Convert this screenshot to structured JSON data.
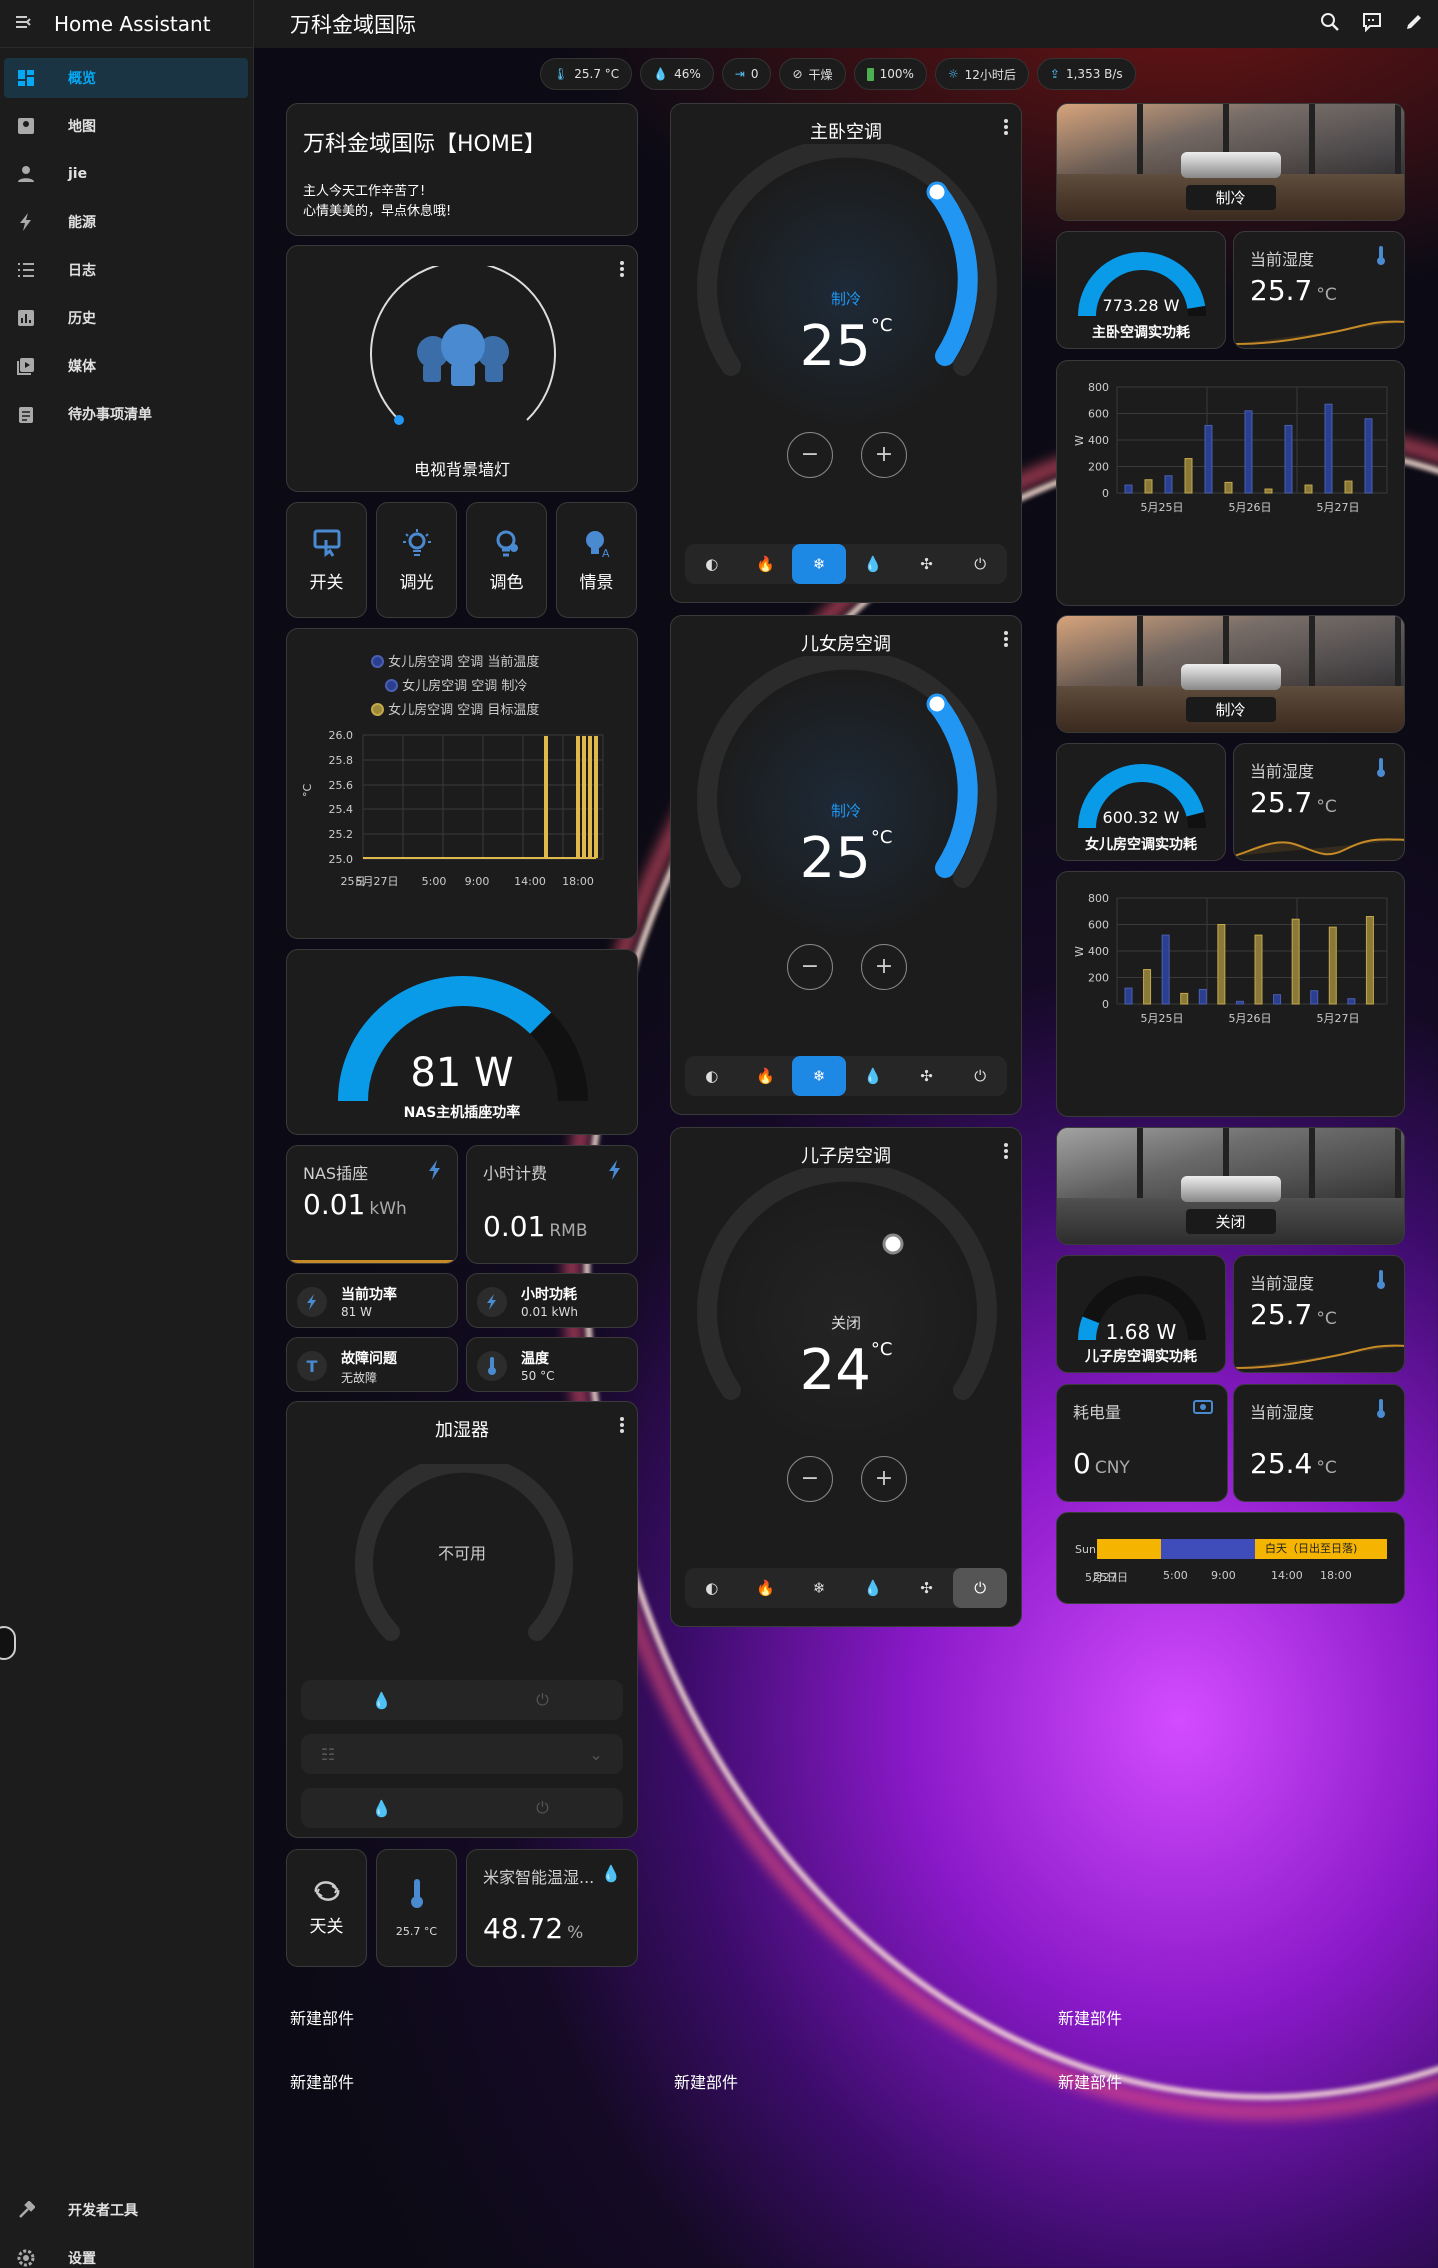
{
  "app": {
    "title": "Home Assistant",
    "page_title": "万科金域国际"
  },
  "sidebar": {
    "items": [
      {
        "label": "概览",
        "icon": "dashboard-icon"
      },
      {
        "label": "地图",
        "icon": "map-icon"
      },
      {
        "label": "jie",
        "icon": "person-icon"
      },
      {
        "label": "能源",
        "icon": "lightning-icon"
      },
      {
        "label": "日志",
        "icon": "list-icon"
      },
      {
        "label": "历史",
        "icon": "chart-icon"
      },
      {
        "label": "媒体",
        "icon": "media-icon"
      },
      {
        "label": "待办事项清单",
        "icon": "clipboard-icon"
      }
    ],
    "bottom": [
      {
        "label": "开发者工具",
        "icon": "hammer-icon"
      },
      {
        "label": "设置",
        "icon": "gear-icon"
      }
    ]
  },
  "badges": [
    {
      "icon": "thermometer-icon",
      "text": "25.7 °C"
    },
    {
      "icon": "drop-icon",
      "text": "46%"
    },
    {
      "icon": "arrow-icon",
      "text": "0"
    },
    {
      "icon": "no-rain-icon",
      "text": "干燥"
    },
    {
      "icon": "battery-icon",
      "text": "100%"
    },
    {
      "icon": "weather-icon",
      "text": "12小时后"
    },
    {
      "icon": "upload-icon",
      "text": "1,353 B/s"
    }
  ],
  "welcome": {
    "title": "万科金域国际【HOME】",
    "line1": "主人今天工作辛苦了!",
    "line2": "心情美美的，早点休息哦!"
  },
  "light": {
    "name": "电视背景墙灯"
  },
  "light_tiles": [
    {
      "label": "开关"
    },
    {
      "label": "调光"
    },
    {
      "label": "调色"
    },
    {
      "label": "情景"
    }
  ],
  "girl_history": {
    "legend": [
      "女儿房空调 空调 当前温度",
      "女儿房空调 空调 制冷",
      "女儿房空调 空调 目标温度"
    ],
    "yticks": [
      "26.0",
      "25.8",
      "25.6",
      "25.4",
      "25.2",
      "25.0"
    ],
    "ylabel": "°C",
    "xticks": [
      "5月27日",
      "5:00",
      "9:00",
      "14:00",
      "18:00"
    ],
    "xticks_overlap": "25日"
  },
  "nas": {
    "value": "81 W",
    "name": "NAS主机插座功率",
    "gauge_fraction": 0.75
  },
  "nas_stats": [
    {
      "label": "NAS插座",
      "value": "0.01",
      "unit": "kWh"
    },
    {
      "label": "小时计费",
      "value": "0.01",
      "unit": "RMB"
    }
  ],
  "nas_entities": [
    {
      "t1": "当前功率",
      "t2": "81 W",
      "icon": "lightning-icon"
    },
    {
      "t1": "小时功耗",
      "t2": "0.01 kWh",
      "icon": "lightning-icon"
    },
    {
      "t1": "故障问题",
      "t2": "无故障",
      "icon": "text-icon"
    },
    {
      "t1": "温度",
      "t2": "50 °C",
      "icon": "thermometer-icon"
    }
  ],
  "humidifier": {
    "title": "加湿器",
    "state": "不可用"
  },
  "bottom_tiles": {
    "switch_label": "天关",
    "temp_text": "25.7 °C",
    "hum_label": "米家智能温湿...",
    "hum_value": "48.72",
    "hum_unit": "%"
  },
  "climates": [
    {
      "title": "主卧空调",
      "mode": "制冷",
      "temp": "25",
      "unit": "°C",
      "active_mode": 2,
      "off": false
    },
    {
      "title": "儿女房空调",
      "mode": "制冷",
      "temp": "25",
      "unit": "°C",
      "active_mode": 2,
      "off": false
    },
    {
      "title": "儿子房空调",
      "mode": "关闭",
      "temp": "24",
      "unit": "°C",
      "active_mode": 5,
      "off": true
    }
  ],
  "climate_minus": "−",
  "climate_plus": "+",
  "rooms": [
    {
      "photo_label": "制冷",
      "power": "773.28 W",
      "power_name": "主卧空调实功耗",
      "gauge_fraction": 0.95,
      "hum_label": "当前湿度",
      "hum_value": "25.7",
      "hum_unit": "°C"
    },
    {
      "photo_label": "制冷",
      "power": "600.32 W",
      "power_name": "女儿房空调实功耗",
      "gauge_fraction": 0.92,
      "hum_label": "当前湿度",
      "hum_value": "25.7",
      "hum_unit": "°C"
    },
    {
      "photo_label": "关闭",
      "power": "1.68 W",
      "power_name": "儿子房空调实功耗",
      "gauge_fraction": 0.12,
      "hum_label": "当前湿度",
      "hum_value": "25.7",
      "hum_unit": "°C"
    }
  ],
  "energy_tiles": [
    {
      "label": "耗电量",
      "value": "0",
      "unit": "CNY"
    },
    {
      "label": "当前湿度",
      "value": "25.4",
      "unit": "°C"
    }
  ],
  "sun": {
    "label": "Sun",
    "day_text": "白天（日出至日落)",
    "xticks": [
      "5月27日",
      "5:00",
      "9:00",
      "14:00",
      "18:00"
    ],
    "xticks_overlap": "25日"
  },
  "new_cards": [
    "新建部件",
    "新建部件",
    "新建部件",
    "新建部件",
    "新建部件"
  ],
  "chart_data": [
    {
      "type": "bar",
      "categories": [
        "5月25日",
        "5月26日",
        "5月27日"
      ],
      "ylabel": "W",
      "yticks": [
        "800",
        "600",
        "400",
        "200",
        "0"
      ],
      "ylim": [
        0,
        800
      ],
      "series": [
        {
          "color": "#2a3f8f",
          "values": [
            [
              60,
              90,
              120,
              100,
              150
            ],
            [
              10,
              80,
              40,
              30,
              10
            ],
            [
              5,
              60,
              10,
              20,
              5
            ]
          ]
        },
        {
          "color": "#9a8a3a",
          "values": [
            [
              40,
              70,
              130,
              260,
              510
            ],
            [
              5,
              620,
              30,
              510,
              20
            ],
            [
              5,
              670,
              90,
              560,
              30
            ]
          ]
        }
      ],
      "bars": [
        60,
        100,
        130,
        260,
        510,
        80,
        620,
        30,
        510,
        60,
        670,
        90,
        560
      ]
    },
    {
      "type": "bar",
      "categories": [
        "5月25日",
        "5月26日",
        "5月27日"
      ],
      "ylabel": "W",
      "yticks": [
        "800",
        "600",
        "400",
        "200",
        "0"
      ],
      "ylim": [
        0,
        800
      ],
      "bars": [
        120,
        260,
        520,
        80,
        110,
        600,
        20,
        520,
        70,
        640,
        100,
        580,
        40,
        660
      ]
    }
  ]
}
